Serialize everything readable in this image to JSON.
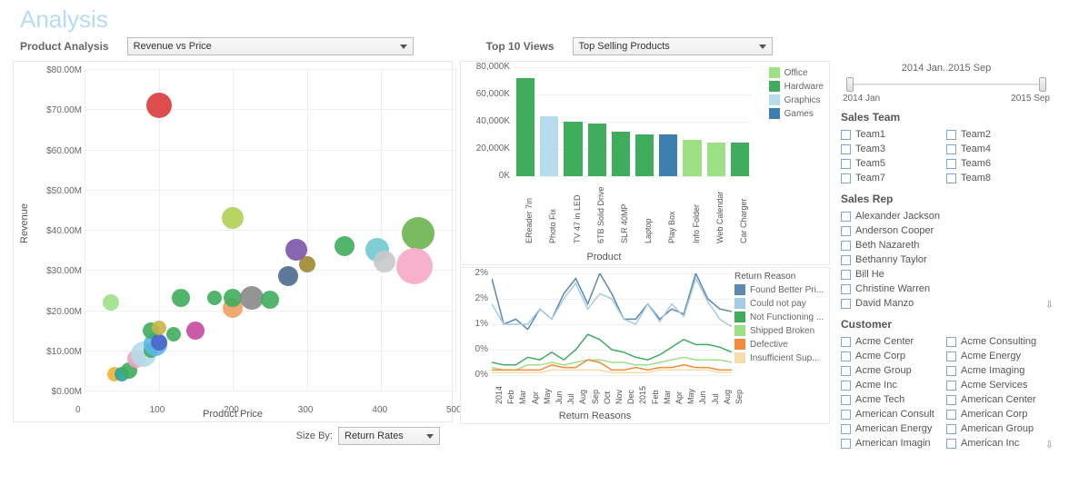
{
  "title": "Analysis",
  "product_analysis_label": "Product Analysis",
  "product_analysis_dropdown": "Revenue vs Price",
  "top10_label": "Top 10 Views",
  "top10_dropdown": "Top Selling Products",
  "sizeby_label": "Size By:",
  "sizeby_dropdown": "Return Rates",
  "time_slider": {
    "caption": "2014 Jan..2015 Sep",
    "start": "2014 Jan",
    "end": "2015 Sep"
  },
  "sales_team_title": "Sales Team",
  "sales_teams": [
    "Team1",
    "Team2",
    "Team3",
    "Team4",
    "Team5",
    "Team6",
    "Team7",
    "Team8"
  ],
  "sales_rep_title": "Sales Rep",
  "sales_reps": [
    "Alexander Jackson",
    "Anderson Cooper",
    "Beth Nazareth",
    "Bethanny Taylor",
    "Bill He",
    "Christine Warren",
    "David Manzo"
  ],
  "customer_title": "Customer",
  "customers_col1": [
    "Acme Center",
    "Acme Corp",
    "Acme Group",
    "Acme Inc",
    "Acme Tech",
    "American Consult",
    "American Energy",
    "American Imagin"
  ],
  "customers_col2": [
    "Acme Consulting",
    "Acme Energy",
    "Acme Imaging",
    "Acme Services",
    "American Center",
    "American Corp",
    "American Group",
    "American Inc"
  ],
  "chart_data": [
    {
      "id": "scatter",
      "type": "scatter",
      "title": null,
      "xlabel": "Product Price",
      "ylabel": "Revenue",
      "xlim": [
        0,
        500
      ],
      "ylim": [
        0,
        80000000
      ],
      "x_ticks": [
        "0",
        "100",
        "200",
        "300",
        "400",
        "500"
      ],
      "y_ticks": [
        "$0.00M",
        "$10.00M",
        "$20.00M",
        "$30.00M",
        "$40.00M",
        "$50.00M",
        "$60.00M",
        "$70.00M",
        "$80.00M"
      ],
      "points": [
        {
          "x": 35,
          "y": 22000000,
          "r": 9,
          "color": "#9ee085"
        },
        {
          "x": 40,
          "y": 4000000,
          "r": 8,
          "color": "#f2b231"
        },
        {
          "x": 50,
          "y": 4000000,
          "r": 8,
          "color": "#2ba3a3"
        },
        {
          "x": 60,
          "y": 5000000,
          "r": 9,
          "color": "#3fad5c"
        },
        {
          "x": 70,
          "y": 8000000,
          "r": 10,
          "color": "#f2a0c0"
        },
        {
          "x": 80,
          "y": 9000000,
          "r": 14,
          "color": "#b4dcea"
        },
        {
          "x": 90,
          "y": 10000000,
          "r": 8,
          "color": "#3fad5c"
        },
        {
          "x": 95,
          "y": 11500000,
          "r": 13,
          "color": "#5cb7e8"
        },
        {
          "x": 90,
          "y": 15000000,
          "r": 9,
          "color": "#3fad5c"
        },
        {
          "x": 100,
          "y": 12000000,
          "r": 9,
          "color": "#4d64c6"
        },
        {
          "x": 100,
          "y": 15500000,
          "r": 8,
          "color": "#c6b349"
        },
        {
          "x": 100,
          "y": 71000000,
          "r": 14,
          "color": "#d93a3a"
        },
        {
          "x": 120,
          "y": 14000000,
          "r": 8,
          "color": "#3fad5c"
        },
        {
          "x": 130,
          "y": 23000000,
          "r": 10,
          "color": "#3fad5c"
        },
        {
          "x": 150,
          "y": 15000000,
          "r": 10,
          "color": "#c7499d"
        },
        {
          "x": 175,
          "y": 23000000,
          "r": 8,
          "color": "#3fad5c"
        },
        {
          "x": 200,
          "y": 43000000,
          "r": 12,
          "color": "#b0cf51"
        },
        {
          "x": 200,
          "y": 20500000,
          "r": 11,
          "color": "#f0a060"
        },
        {
          "x": 200,
          "y": 23000000,
          "r": 10,
          "color": "#3fad5c"
        },
        {
          "x": 225,
          "y": 23000000,
          "r": 13,
          "color": "#888"
        },
        {
          "x": 250,
          "y": 22500000,
          "r": 10,
          "color": "#3fad5c"
        },
        {
          "x": 275,
          "y": 28500000,
          "r": 11,
          "color": "#4a6a90"
        },
        {
          "x": 300,
          "y": 31500000,
          "r": 9,
          "color": "#9e8730"
        },
        {
          "x": 285,
          "y": 35000000,
          "r": 12,
          "color": "#7c53a6"
        },
        {
          "x": 350,
          "y": 36000000,
          "r": 11,
          "color": "#3fad5c"
        },
        {
          "x": 395,
          "y": 35000000,
          "r": 13,
          "color": "#70c9d1"
        },
        {
          "x": 405,
          "y": 32000000,
          "r": 12,
          "color": "#c9c9c9"
        },
        {
          "x": 450,
          "y": 39000000,
          "r": 18,
          "color": "#6cb34f"
        },
        {
          "x": 445,
          "y": 31000000,
          "r": 20,
          "color": "#f5aac8"
        }
      ]
    },
    {
      "id": "top10bar",
      "type": "bar",
      "xlabel": "Product",
      "ylabel": null,
      "ylim": [
        0,
        80000
      ],
      "y_ticks": [
        "0K",
        "20,000K",
        "40,000K",
        "60,000K",
        "80,000K"
      ],
      "legend": [
        {
          "name": "Office",
          "color": "#9ee085"
        },
        {
          "name": "Hardware",
          "color": "#3fad5c"
        },
        {
          "name": "Graphics",
          "color": "#b4dcea"
        },
        {
          "name": "Games",
          "color": "#3c7fb0"
        }
      ],
      "bars": [
        {
          "label": "EReader 7in",
          "value": 72000,
          "color": "#3fad5c"
        },
        {
          "label": "Photo Fix",
          "value": 44000,
          "color": "#b4dcea"
        },
        {
          "label": "TV 47 in LED",
          "value": 40000,
          "color": "#3fad5c"
        },
        {
          "label": "6TB Solid Drive",
          "value": 39000,
          "color": "#3fad5c"
        },
        {
          "label": "SLR 40MP",
          "value": 33000,
          "color": "#3fad5c"
        },
        {
          "label": "Laptop",
          "value": 31000,
          "color": "#3fad5c"
        },
        {
          "label": "Play Box",
          "value": 31000,
          "color": "#3c7fb0"
        },
        {
          "label": "Info Folder",
          "value": 27000,
          "color": "#9ee085"
        },
        {
          "label": "Web Calendar",
          "value": 25000,
          "color": "#9ee085"
        },
        {
          "label": "Car Charger",
          "value": 25000,
          "color": "#3fad5c"
        }
      ]
    },
    {
      "id": "returns",
      "type": "line",
      "title": "Return Reasons",
      "ylim": [
        0,
        2
      ],
      "y_ticks": [
        "0%",
        "0%",
        "1%",
        "2%",
        "2%"
      ],
      "legend_title": "Return Reason",
      "legend": [
        {
          "name": "Found Better Pri...",
          "color": "#5b89b0"
        },
        {
          "name": "Could not pay",
          "color": "#a6cbe6"
        },
        {
          "name": "Not Functioning ...",
          "color": "#3fad5c"
        },
        {
          "name": "Shipped Broken",
          "color": "#9ee085"
        },
        {
          "name": "Defective",
          "color": "#f28b3d"
        },
        {
          "name": "Insufficient Sup...",
          "color": "#f5dca8"
        }
      ],
      "categories": [
        "2014",
        "Feb",
        "Mar",
        "Apr",
        "May",
        "Jun",
        "Jul",
        "Aug",
        "Sep",
        "Oct",
        "Nov",
        "Dec",
        "2015",
        "Feb",
        "Mar",
        "Apr",
        "May",
        "Jun",
        "Jul",
        "Aug",
        "Sep"
      ],
      "series": [
        {
          "name": "Found Better Pri...",
          "color": "#5b89b0",
          "values": [
            1.9,
            1.0,
            1.1,
            0.9,
            1.3,
            1.1,
            1.6,
            1.9,
            1.4,
            2.0,
            1.6,
            1.1,
            1.1,
            1.4,
            1.1,
            1.3,
            1.2,
            2.0,
            1.5,
            1.3,
            1.25
          ]
        },
        {
          "name": "Could not pay",
          "color": "#a6cbe6",
          "values": [
            1.4,
            1.0,
            1.0,
            1.0,
            1.3,
            1.1,
            1.5,
            1.8,
            1.3,
            1.6,
            1.5,
            1.1,
            1.0,
            1.4,
            1.05,
            1.4,
            1.15,
            1.9,
            1.45,
            1.1,
            0.95
          ]
        },
        {
          "name": "Not Functioning ...",
          "color": "#3fad5c",
          "values": [
            0.25,
            0.2,
            0.2,
            0.35,
            0.3,
            0.45,
            0.3,
            0.5,
            0.8,
            0.7,
            0.5,
            0.45,
            0.35,
            0.3,
            0.4,
            0.55,
            0.7,
            0.6,
            0.6,
            0.55,
            0.45
          ]
        },
        {
          "name": "Shipped Broken",
          "color": "#9ee085",
          "values": [
            0.15,
            0.1,
            0.1,
            0.2,
            0.2,
            0.25,
            0.2,
            0.25,
            0.3,
            0.3,
            0.25,
            0.25,
            0.2,
            0.2,
            0.25,
            0.3,
            0.35,
            0.3,
            0.3,
            0.3,
            0.25
          ]
        },
        {
          "name": "Defective",
          "color": "#f28b3d",
          "values": [
            0.1,
            0.1,
            0.1,
            0.1,
            0.1,
            0.2,
            0.15,
            0.15,
            0.3,
            0.25,
            0.1,
            0.1,
            0.15,
            0.1,
            0.15,
            0.15,
            0.2,
            0.15,
            0.15,
            0.1,
            0.1
          ]
        },
        {
          "name": "Insufficient Sup...",
          "color": "#f5dca8",
          "values": [
            0.05,
            0.05,
            0.05,
            0.05,
            0.05,
            0.1,
            0.1,
            0.1,
            0.1,
            0.1,
            0.05,
            0.05,
            0.05,
            0.05,
            0.1,
            0.1,
            0.1,
            0.1,
            0.1,
            0.05,
            0.05
          ]
        }
      ]
    }
  ]
}
